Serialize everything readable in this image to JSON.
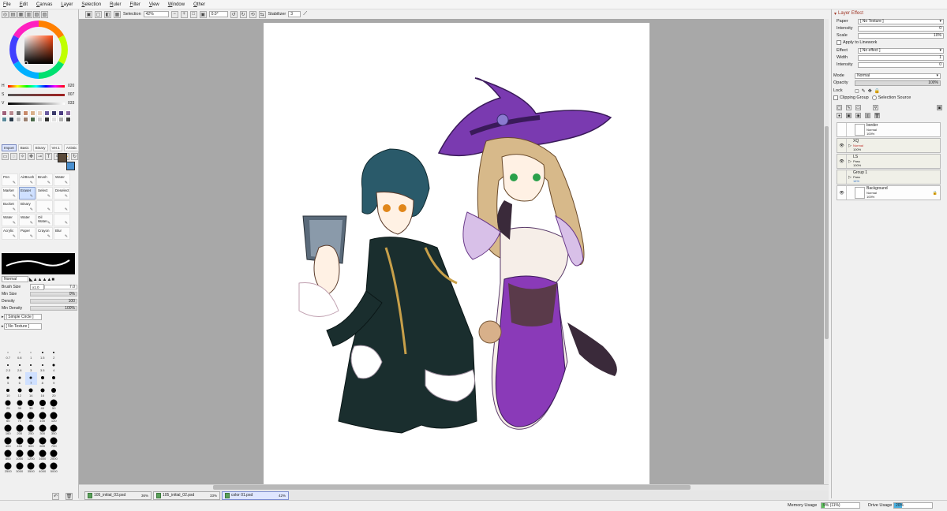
{
  "menu": [
    "File",
    "Edit",
    "Canvas",
    "Layer",
    "Selection",
    "Ruler",
    "Filter",
    "View",
    "Window",
    "Other"
  ],
  "toolbar": {
    "selection_label": "Selection",
    "zoom": "42%",
    "rotation": "0.0°",
    "stabilizer_label": "Stabilizer",
    "stabilizer_value": "3"
  },
  "color": {
    "h_label": "H",
    "h_value": "020",
    "s_label": "S",
    "s_value": "007",
    "v_label": "V",
    "v_value": "033",
    "swatches": [
      "#a0607a",
      "#b98a90",
      "#707070",
      "#c88a6a",
      "#d9b08a",
      "#e8d2c0",
      "#6a5aa0",
      "#3a3a6a",
      "#4a3a80",
      "#8a6aa0",
      "#5a8a9a",
      "#2a3a4a",
      "#c0c0c0",
      "#9a8070",
      "#4a6a4a",
      "#d0d0d0",
      "#303030",
      "#e0e0e0",
      "#b0b0b0",
      "#404040"
    ]
  },
  "tool_tabs": [
    "Import",
    "Basic",
    "Binary",
    "Ver.1",
    "Artistic"
  ],
  "brushes": [
    {
      "label": "Pen",
      "selected": false
    },
    {
      "label": "AirBrush",
      "selected": false
    },
    {
      "label": "Brush",
      "selected": false
    },
    {
      "label": "Water",
      "selected": false
    },
    {
      "label": "Marker",
      "selected": false
    },
    {
      "label": "Eraser",
      "selected": true
    },
    {
      "label": "Select",
      "selected": false
    },
    {
      "label": "Deselect",
      "selected": false
    },
    {
      "label": "Bucket",
      "selected": false
    },
    {
      "label": "Binary",
      "selected": false
    },
    {
      "label": "",
      "selected": false
    },
    {
      "label": "",
      "selected": false
    },
    {
      "label": "Water",
      "selected": false
    },
    {
      "label": "Water",
      "selected": false
    },
    {
      "label": "Oil Water",
      "selected": false
    },
    {
      "label": "",
      "selected": false
    },
    {
      "label": "Acrylic",
      "selected": false
    },
    {
      "label": "Paper",
      "selected": false
    },
    {
      "label": "Crayon",
      "selected": false
    },
    {
      "label": "Blur",
      "selected": false
    }
  ],
  "brush_props": {
    "blend_mode": "Normal",
    "size_label": "Brush Size",
    "size_mult": "x1.0",
    "size_value": "7.0",
    "min_size_label": "Min Size",
    "min_size_value": "0%",
    "density_label": "Density",
    "density_value": "100",
    "min_density_label": "Min Density",
    "min_density_value": "100%",
    "shape": "[ Simple Circle ]",
    "texture": "[ No Texture ]"
  },
  "brush_sizes": [
    "0.7",
    "0.8",
    "1",
    "1.5",
    "2",
    "",
    "2.3",
    "2.6",
    "3",
    "3.5",
    "4",
    "",
    "5",
    "6",
    "7",
    "8",
    "9",
    "",
    "10",
    "12",
    "14",
    "16",
    "20",
    "",
    "25",
    "30",
    "35",
    "40",
    "50",
    "",
    "60",
    "70",
    "80",
    "100",
    "120",
    "",
    "160",
    "200",
    "250",
    "300",
    "350",
    "",
    "400",
    "450",
    "500",
    "600",
    "700",
    "",
    "800",
    "1000",
    "1200",
    "1600",
    "2000",
    "",
    "2500",
    "3000",
    "3500",
    "4000",
    "5000",
    ""
  ],
  "right": {
    "header": "Layer Effect",
    "paper_label": "Paper",
    "paper_value": "[ No Texture ]",
    "intensity_label": "Intensity",
    "intensity_value": "0",
    "scale_label": "Scale",
    "scale_value": "10%",
    "apply_linework": "Apply to Linework",
    "effect_label": "Effect",
    "effect_value": "[ No effect ]",
    "width_label": "Width",
    "width_value": "1",
    "intensity2_label": "Intensity",
    "intensity2_value": "0",
    "mode_label": "Mode",
    "mode_value": "Normal",
    "opacity_label": "Opacity",
    "opacity_value": "100%",
    "lock_label": "Lock",
    "clipping_label": "Clipping Group",
    "selection_source_label": "Selection Source"
  },
  "layers": [
    {
      "name": "border",
      "mode": "Normal",
      "opacity": "100%",
      "visible": false,
      "group": false,
      "mode_color": "#222"
    },
    {
      "name": "XQ",
      "mode": "Normal",
      "opacity": "100%",
      "visible": true,
      "group": true,
      "mode_color": "#c0302a"
    },
    {
      "name": "LS",
      "mode": "Pass",
      "opacity": "100%",
      "visible": true,
      "group": true,
      "mode_color": "#222"
    },
    {
      "name": "Group 1",
      "mode": "Pass",
      "opacity": "14%",
      "visible": false,
      "group": true,
      "mode_color": "#222"
    },
    {
      "name": "Background",
      "mode": "Normal",
      "opacity": "100%",
      "visible": true,
      "group": false,
      "mode_color": "#222"
    }
  ],
  "doc_tabs": [
    {
      "name": "105_initial_03.psd",
      "zoom": "36%",
      "active": false
    },
    {
      "name": "105_initial_02.psd",
      "zoom": "33%",
      "active": false
    },
    {
      "name": "color 01.psd",
      "zoom": "42%",
      "active": true
    }
  ],
  "status": {
    "memory_label": "Memory Usage",
    "memory_value": "9% (11%)",
    "memory_fill": 0.09,
    "drive_label": "Drive Usage",
    "drive_value": "20%",
    "drive_fill": 0.2
  }
}
